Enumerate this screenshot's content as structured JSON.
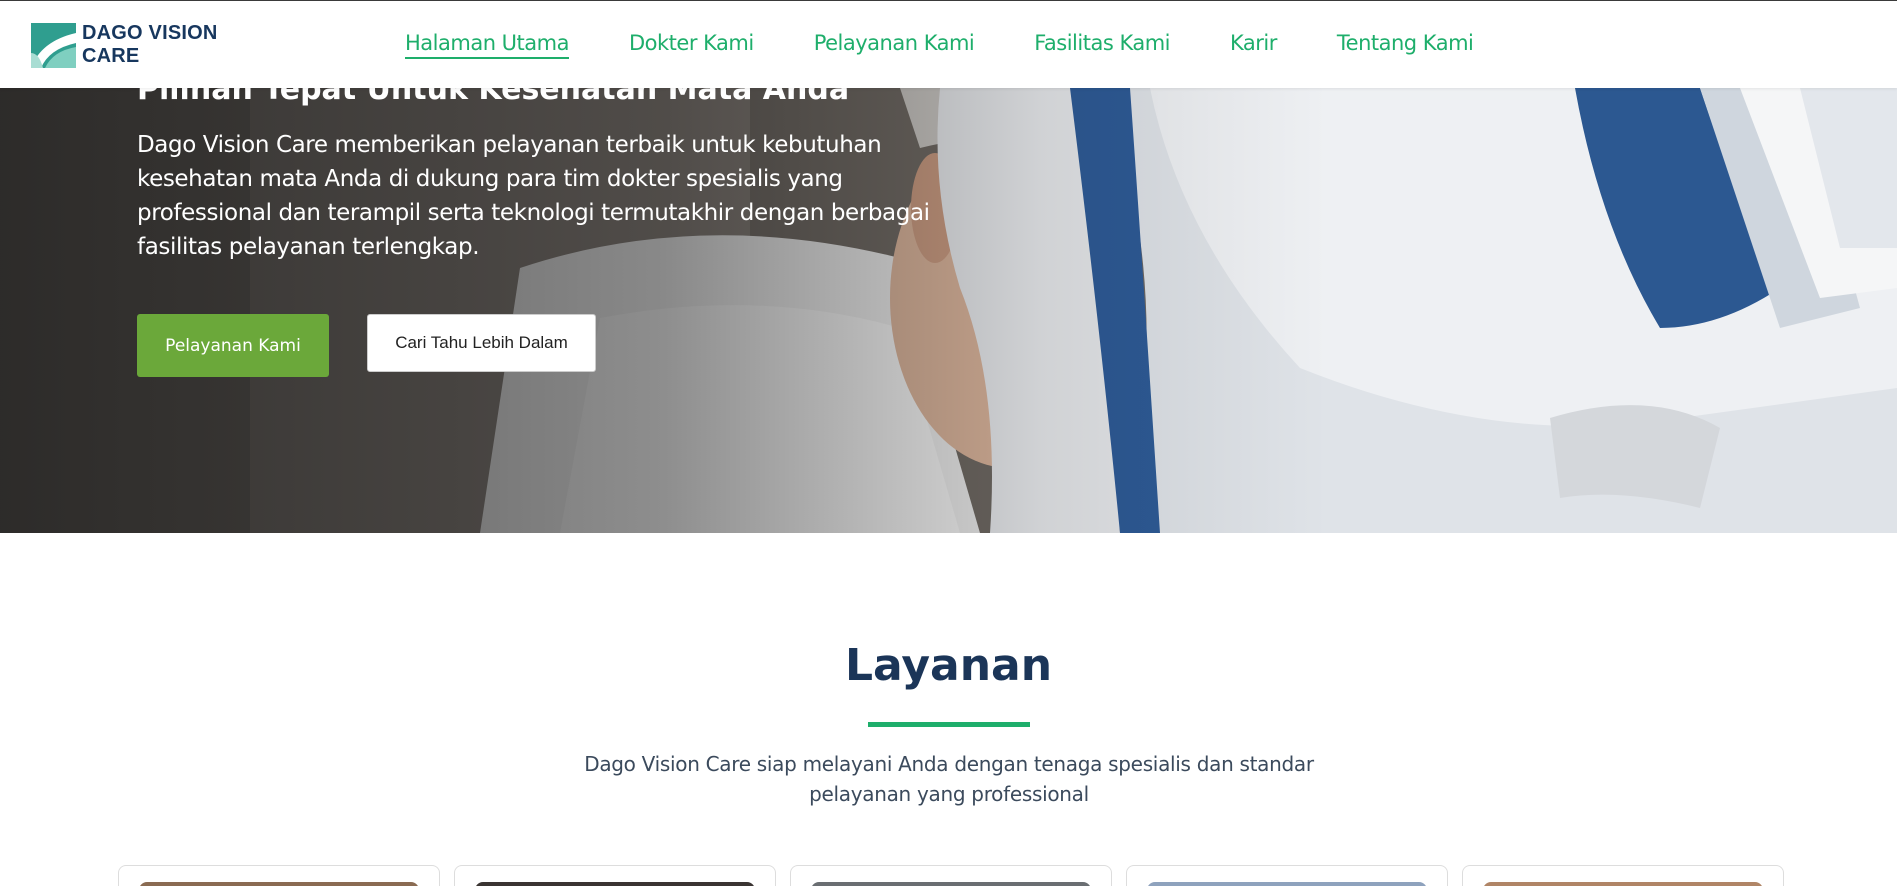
{
  "brand": {
    "name_line1": "DAGO VISION",
    "name_line2": "CARE",
    "colors": {
      "navy": "#17375e",
      "green": "#1eae6b",
      "button_green": "#6ba83a"
    }
  },
  "nav": {
    "items": [
      {
        "label": "Halaman Utama",
        "active": true
      },
      {
        "label": "Dokter Kami",
        "active": false
      },
      {
        "label": "Pelayanan Kami",
        "active": false
      },
      {
        "label": "Fasilitas Kami",
        "active": false
      },
      {
        "label": "Karir",
        "active": false
      },
      {
        "label": "Tentang Kami",
        "active": false
      }
    ]
  },
  "hero": {
    "title": "Pilihan Tepat Untuk Kesehatan Mata Anda",
    "description": "Dago Vision Care memberikan pelayanan terbaik untuk kebutuhan kesehatan mata Anda di dukung para tim dokter spesialis yang professional dan terampil serta teknologi termutakhir dengan berbagai fasilitas pelayanan terlengkap.",
    "primary_button": "Pelayanan Kami",
    "secondary_button": "Cari Tahu Lebih Dalam"
  },
  "services": {
    "title": "Layanan",
    "description": "Dago Vision Care siap melayani Anda dengan tenaga spesialis dan standar pelayanan yang professional"
  }
}
